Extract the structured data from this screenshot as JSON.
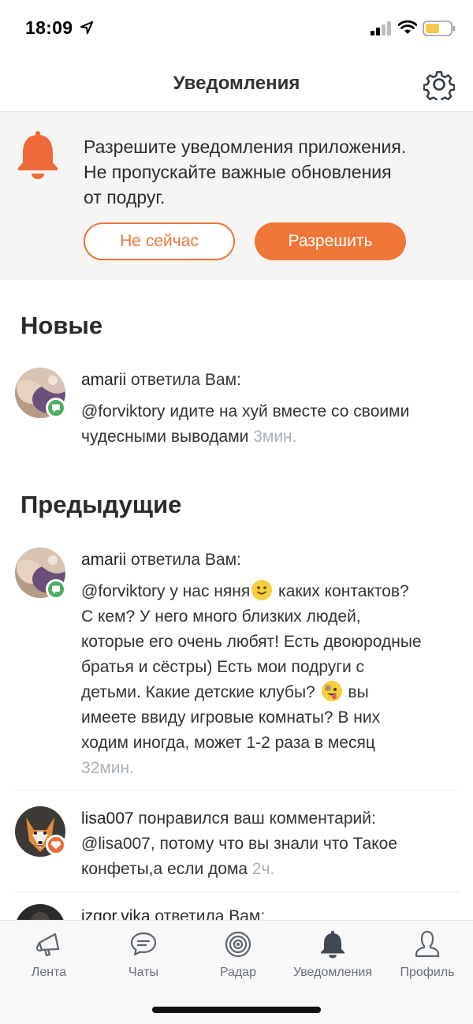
{
  "status_bar": {
    "time": "18:09"
  },
  "header": {
    "title": "Уведомления",
    "settings_icon": "gear-icon"
  },
  "banner": {
    "icon": "bell-icon",
    "line1": "Разрешите уведомления приложения.",
    "line2": "Не пропускайте важные обновления",
    "line3": "от подруг.",
    "later_label": "Не сейчас",
    "allow_label": "Разрешить"
  },
  "sections": {
    "new_title": "Новые",
    "previous_title": "Предыдущие"
  },
  "notifications": [
    {
      "user": "amarii",
      "action": "ответила Вам:",
      "lines": [
        "@forviktory идите на хуй вместе со своими",
        "чудесными выводами "
      ],
      "time": "3мин.",
      "badge": "comment-icon"
    },
    {
      "user": "amarii",
      "action": "ответила Вам:",
      "seg1": "@forviktory у нас няня",
      "seg2": " каких контактов?",
      "lines": [
        "С кем? У него много близких людей,",
        "которые его очень любят! Есть двоюродные",
        "братья и сёстры) Есть мои подруги с"
      ],
      "seg3": "детьми. Какие детские клубы? ",
      "seg4": " вы",
      "lines2": [
        "имеете ввиду игровые комнаты? В них",
        "ходим иногда, может 1-2 раза в месяц"
      ],
      "time": "32мин.",
      "badge": "comment-icon"
    },
    {
      "user": "lisa007",
      "action": "понравился ваш комментарий:",
      "lines": [
        "@lisa007, потому что вы знали что Такое",
        "конфеты,а если дома "
      ],
      "time": "2ч.",
      "badge": "heart-icon"
    },
    {
      "user": "izgor.vika",
      "action": "ответила Вам:"
    }
  ],
  "tabs": [
    {
      "label": "Лента",
      "icon": "megaphone-icon"
    },
    {
      "label": "Чаты",
      "icon": "chat-icon"
    },
    {
      "label": "Радар",
      "icon": "radar-icon"
    },
    {
      "label": "Уведомления",
      "icon": "bell-icon"
    },
    {
      "label": "Профиль",
      "icon": "profile-icon"
    }
  ],
  "colors": {
    "accent": "#ee7637",
    "badge_green": "#4caf64",
    "muted": "#a9b1b8"
  }
}
